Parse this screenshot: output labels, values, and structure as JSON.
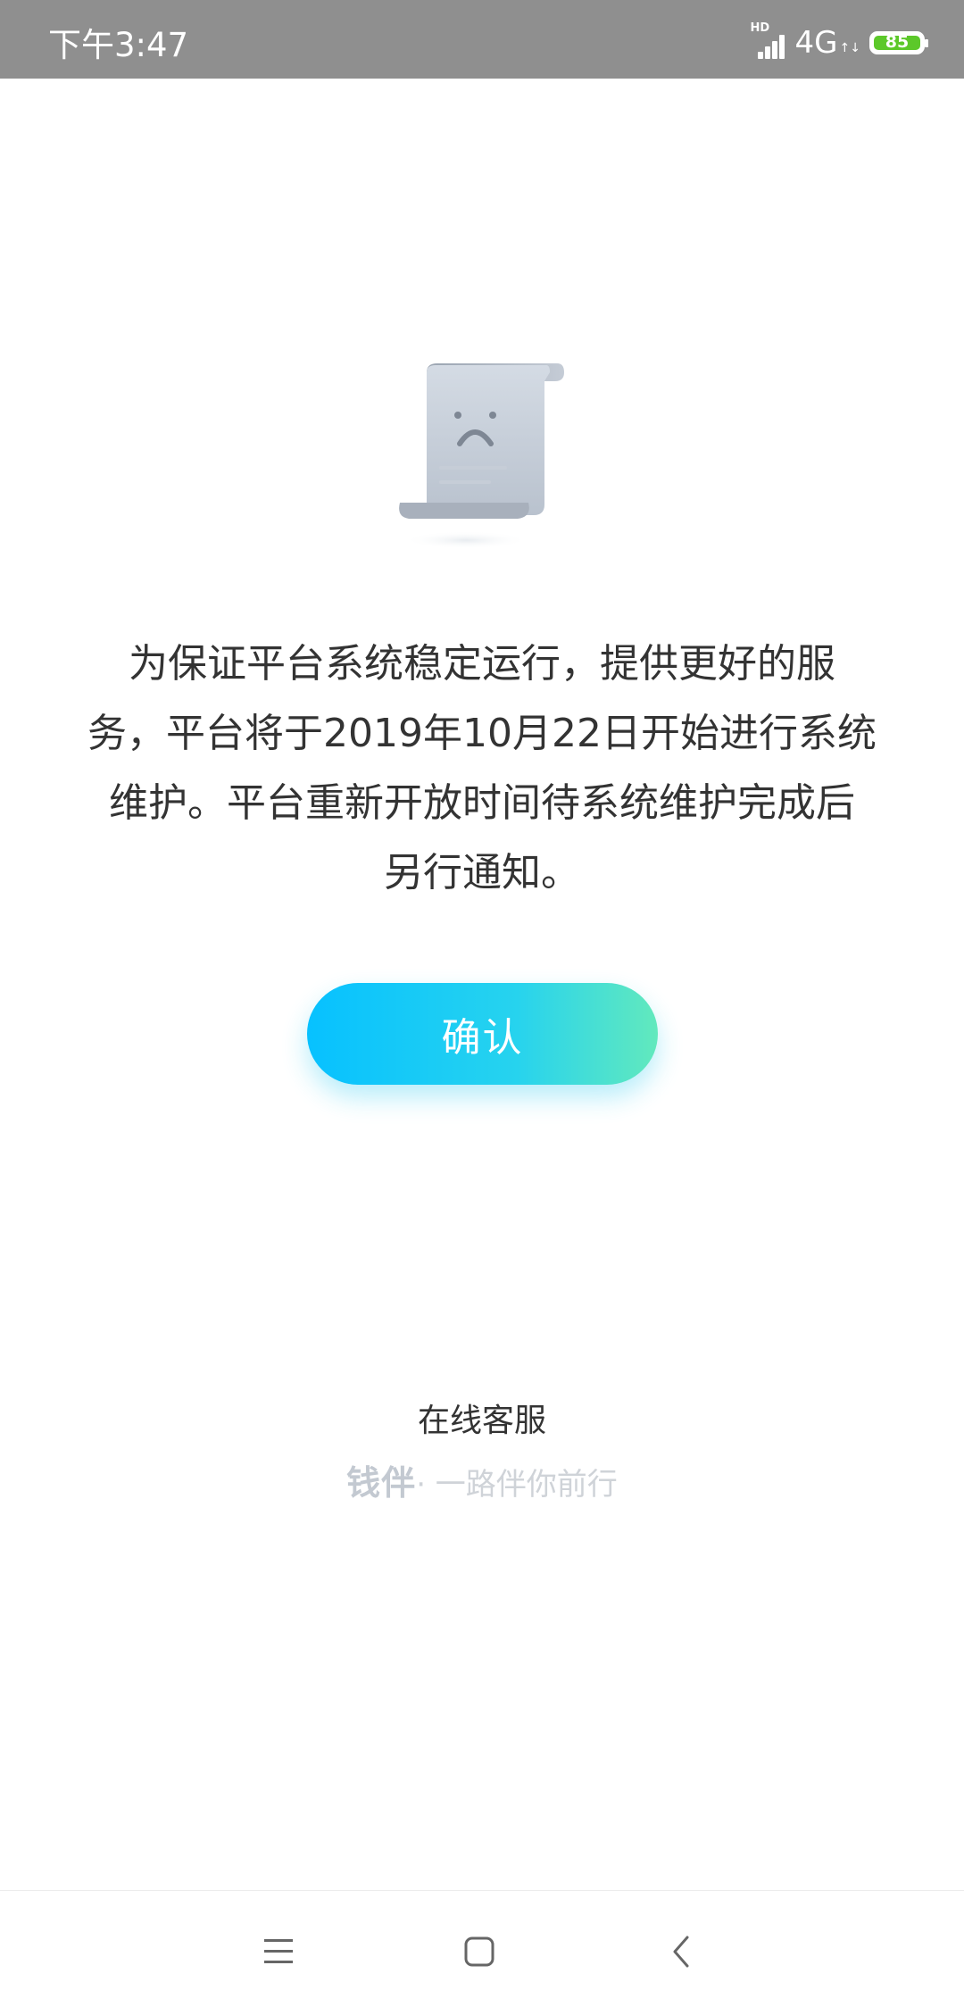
{
  "status_bar": {
    "time": "下午3:47",
    "hd_label": "HD",
    "network": "4G",
    "battery": "85",
    "icons": [
      "signal-icon",
      "data-arrows-icon",
      "battery-icon"
    ]
  },
  "illustration": {
    "icon": "sad-document-icon"
  },
  "notice": {
    "lines": [
      "为保证平台系统稳定运行，提供更好的服",
      "务，平台将于2019年10月22日开始进行系统",
      "维护。平台重新开放时间待系统维护完成后",
      "另行通知。"
    ]
  },
  "confirm_button": {
    "label": "确认"
  },
  "customer_service": {
    "label": "在线客服"
  },
  "footer": {
    "brand": "钱伴",
    "slogan": "· 一路伴你前行"
  },
  "colors": {
    "status_bar_bg": "#8f8f8f",
    "button_gradient_start": "#07c1ff",
    "button_gradient_end": "#62e9bd",
    "text": "#333333",
    "battery": "#5cc82a"
  },
  "nav_bar": {
    "icons": [
      "menu-icon",
      "home-icon",
      "back-icon"
    ]
  }
}
